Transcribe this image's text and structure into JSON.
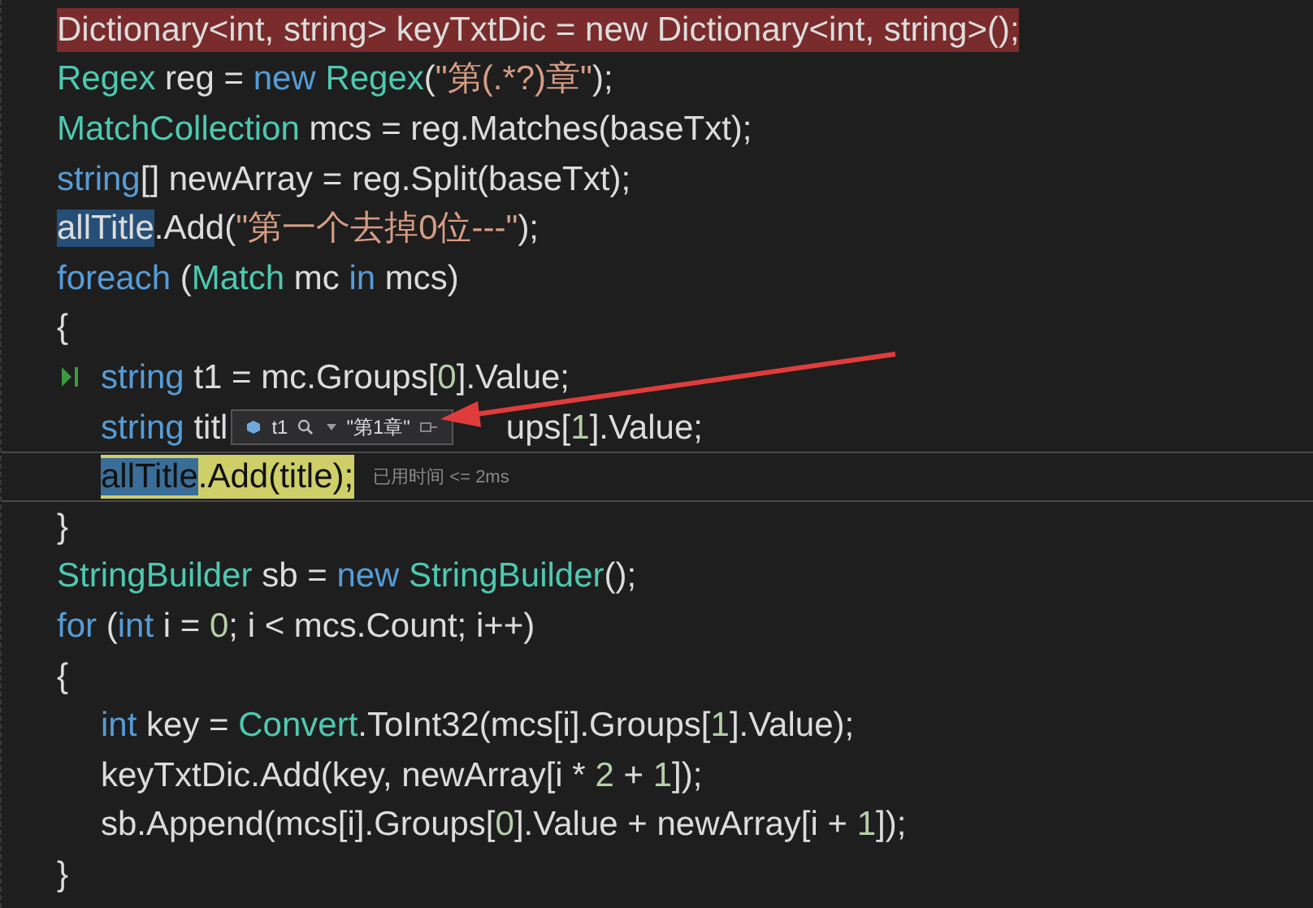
{
  "code_lines": [
    {
      "breakpoint": true,
      "tokens": [
        {
          "text": "Dictionary<int, string> keyTxtDic = new Dictionary<int, string>();",
          "kind": "plain"
        }
      ]
    },
    {
      "tokens": [
        {
          "text": "Regex",
          "kind": "type"
        },
        {
          "text": " reg = ",
          "kind": "plain"
        },
        {
          "text": "new",
          "kind": "keyword"
        },
        {
          "text": " Regex",
          "kind": "type"
        },
        {
          "text": "(",
          "kind": "plain"
        },
        {
          "text": "\"第(.*?)章\"",
          "kind": "string"
        },
        {
          "text": ");",
          "kind": "plain"
        }
      ]
    },
    {
      "tokens": [
        {
          "text": "MatchCollection",
          "kind": "type"
        },
        {
          "text": " mcs = reg.Matches(baseTxt);",
          "kind": "plain"
        }
      ]
    },
    {
      "tokens": [
        {
          "text": "string",
          "kind": "keyword"
        },
        {
          "text": "[] newArray = reg.Split(baseTxt);",
          "kind": "plain"
        }
      ]
    },
    {
      "tokens": [
        {
          "text": "allTitle",
          "kind": "reference"
        },
        {
          "text": ".Add(",
          "kind": "plain"
        },
        {
          "text": "\"第一个去掉0位---\"",
          "kind": "string"
        },
        {
          "text": ");",
          "kind": "plain"
        }
      ]
    },
    {
      "tokens": [
        {
          "text": "foreach",
          "kind": "keyword"
        },
        {
          "text": " (",
          "kind": "plain"
        },
        {
          "text": "Match",
          "kind": "type"
        },
        {
          "text": " mc ",
          "kind": "plain"
        },
        {
          "text": "in",
          "kind": "keyword"
        },
        {
          "text": " mcs)",
          "kind": "plain"
        }
      ]
    },
    {
      "tokens": [
        {
          "text": "{",
          "kind": "plain"
        }
      ],
      "children": [
        {
          "marker": true,
          "tokens": [
            {
              "text": "string",
              "kind": "keyword"
            },
            {
              "text": " t1 = mc.Groups[",
              "kind": "plain"
            },
            {
              "text": "0",
              "kind": "number"
            },
            {
              "text": "].Value;",
              "kind": "plain"
            }
          ]
        },
        {
          "tokens": [
            {
              "text": "string",
              "kind": "keyword"
            },
            {
              "text": " titl",
              "kind": "plain"
            },
            {
              "kind": "datatip",
              "name": "t1",
              "value": "\"第1章\""
            },
            {
              "text": "ups[",
              "kind": "plain"
            },
            {
              "text": "1",
              "kind": "number"
            },
            {
              "text": "].Value;",
              "kind": "plain"
            }
          ]
        },
        {
          "current": true,
          "perf_tip": "已用时间 <= 2ms",
          "tokens": [
            {
              "text": "allTitle",
              "kind": "reference"
            },
            {
              "text": ".Add(title);",
              "kind": "plain"
            }
          ]
        }
      ]
    },
    {
      "tokens": [
        {
          "text": "}",
          "kind": "plain"
        }
      ]
    },
    {
      "tokens": [
        {
          "text": "StringBuilder",
          "kind": "type"
        },
        {
          "text": " sb = ",
          "kind": "plain"
        },
        {
          "text": "new",
          "kind": "keyword"
        },
        {
          "text": " StringBuilder",
          "kind": "type"
        },
        {
          "text": "();",
          "kind": "plain"
        }
      ]
    },
    {
      "tokens": [
        {
          "text": "for",
          "kind": "keyword"
        },
        {
          "text": " (",
          "kind": "plain"
        },
        {
          "text": "int",
          "kind": "keyword"
        },
        {
          "text": " i = ",
          "kind": "plain"
        },
        {
          "text": "0",
          "kind": "number"
        },
        {
          "text": "; i < mcs.Count; i++)",
          "kind": "plain"
        }
      ]
    },
    {
      "tokens": [
        {
          "text": "{",
          "kind": "plain"
        }
      ],
      "children": [
        {
          "tokens": [
            {
              "text": "int",
              "kind": "keyword"
            },
            {
              "text": " key = ",
              "kind": "plain"
            },
            {
              "text": "Convert",
              "kind": "type"
            },
            {
              "text": ".ToInt32(mcs[i].Groups[",
              "kind": "plain"
            },
            {
              "text": "1",
              "kind": "number"
            },
            {
              "text": "].Value);",
              "kind": "plain"
            }
          ]
        },
        {
          "tokens": [
            {
              "text": "keyTxtDic.Add(key, newArray[i * ",
              "kind": "plain"
            },
            {
              "text": "2",
              "kind": "number"
            },
            {
              "text": " + ",
              "kind": "plain"
            },
            {
              "text": "1",
              "kind": "number"
            },
            {
              "text": "]);",
              "kind": "plain"
            }
          ]
        },
        {
          "tokens": [
            {
              "text": "sb.Append(mcs[i].Groups[",
              "kind": "plain"
            },
            {
              "text": "0",
              "kind": "number"
            },
            {
              "text": "].Value + newArray[i + ",
              "kind": "plain"
            },
            {
              "text": "1",
              "kind": "number"
            },
            {
              "text": "]);",
              "kind": "plain"
            }
          ]
        }
      ]
    },
    {
      "tokens": [
        {
          "text": "}",
          "kind": "plain"
        }
      ]
    }
  ]
}
